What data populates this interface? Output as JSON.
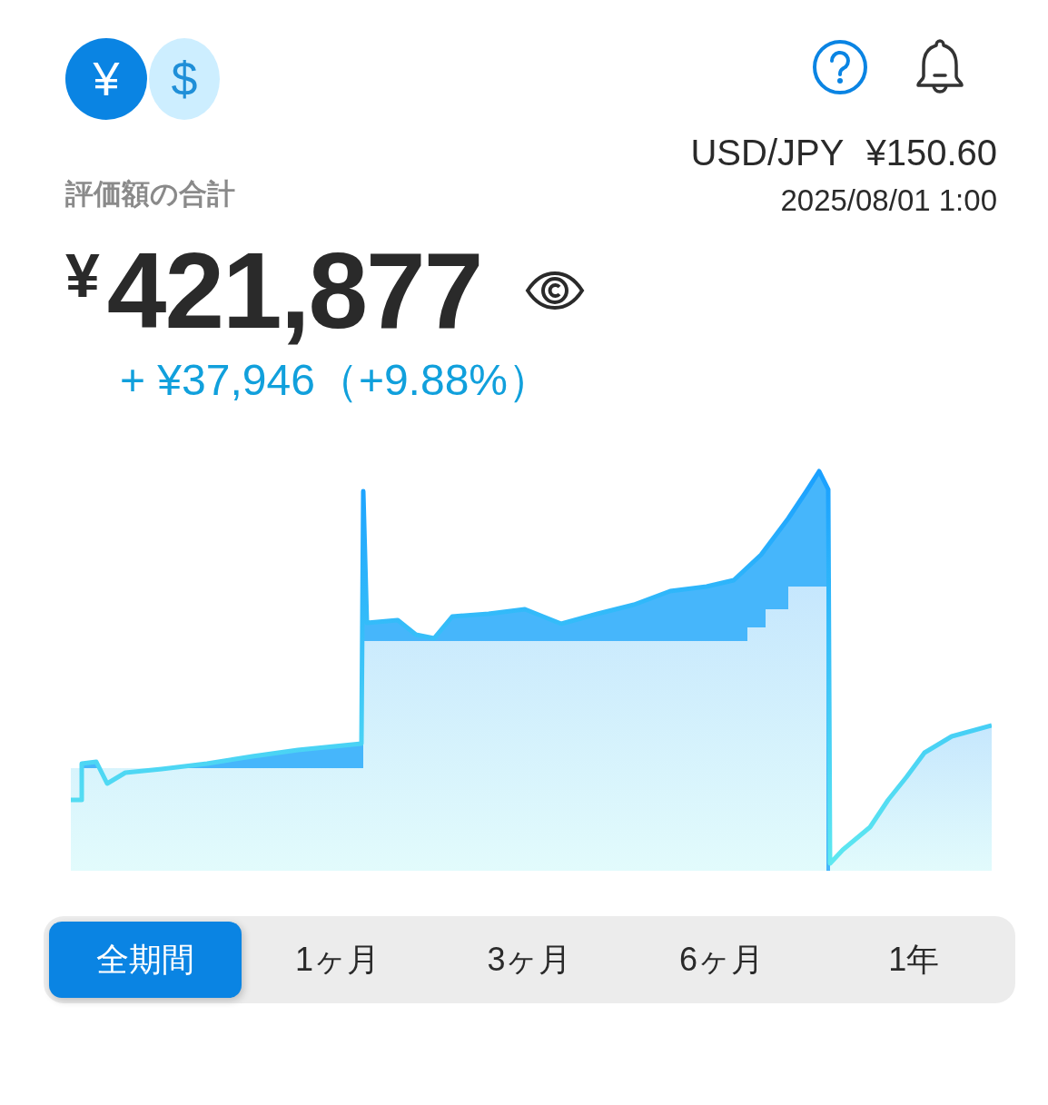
{
  "currency_toggle": [
    {
      "symbol": "¥",
      "selected": true
    },
    {
      "symbol": "$",
      "selected": false
    }
  ],
  "rate": {
    "pair": "USD/JPY",
    "value": "¥150.60",
    "timestamp": "2025/08/01 1:00"
  },
  "total": {
    "label": "評価額の合計",
    "currency": "¥",
    "amount": "421,877",
    "change": "+ ¥37,946（+9.88%）"
  },
  "periods": [
    {
      "label": "全期間",
      "selected": true
    },
    {
      "label": "1ヶ月",
      "selected": false
    },
    {
      "label": "3ヶ月",
      "selected": false
    },
    {
      "label": "6ヶ月",
      "selected": false
    },
    {
      "label": "1年",
      "selected": false
    }
  ]
}
